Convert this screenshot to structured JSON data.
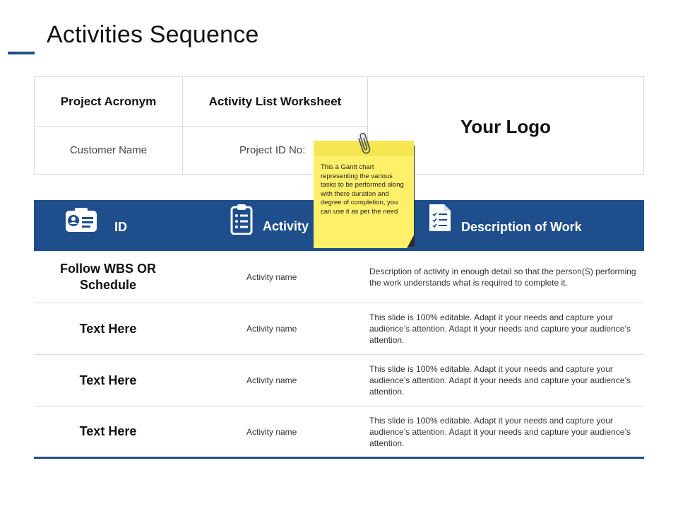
{
  "page": {
    "title": "Activities Sequence"
  },
  "info_table": {
    "project_acronym": "Project Acronym",
    "activity_list_worksheet": "Activity List Worksheet",
    "customer_name": "Customer Name",
    "project_id": "Project ID No:",
    "logo": "Your Logo"
  },
  "sticky_note": {
    "text": "This a Gantt chart representing the various tasks to be performed along with there duration and degree of completion, you can use it as per the need"
  },
  "table": {
    "headers": {
      "id": "ID",
      "activity": "Activity",
      "description": "Description of Work"
    },
    "rows": [
      {
        "id": "Follow WBS OR Schedule",
        "activity": "Activity name",
        "description": "Description of activity in enough detail so that the person(S) performing the work understands what is required to complete it."
      },
      {
        "id": "Text Here",
        "activity": "Activity name",
        "description": "This slide is 100% editable. Adapt it your needs and capture your audience’s attention. Adapt it your needs and capture your audience’s attention."
      },
      {
        "id": "Text Here",
        "activity": "Activity name",
        "description": "This slide is 100% editable. Adapt it your needs and capture your audience’s attention. Adapt it your needs and capture your audience’s attention."
      },
      {
        "id": "Text Here",
        "activity": "Activity name",
        "description": "This slide is 100% editable. Adapt it your needs and capture your audience’s attention. Adapt it your needs and capture your audience’s attention."
      }
    ]
  },
  "icons": {
    "id_header": "id-card-icon",
    "activity_header": "clipboard-list-icon",
    "description_header": "document-checklist-icon",
    "sticky": "paperclip-icon"
  },
  "colors": {
    "accent": "#1f4e8c",
    "sticky": "#fff06a"
  }
}
